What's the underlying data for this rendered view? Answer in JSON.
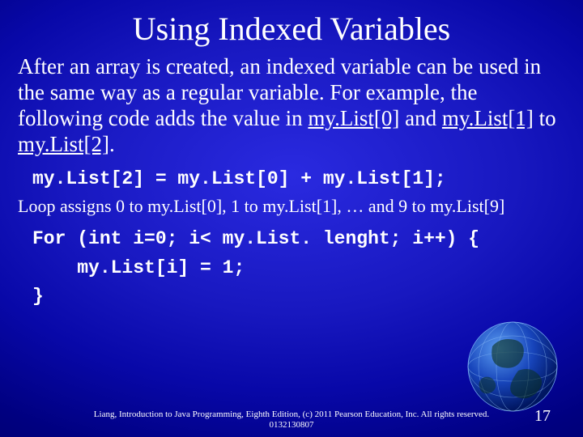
{
  "title": "Using Indexed Variables",
  "para_lead": "After an array is created, an indexed variable can be used in the same way as a regular variable. For example, the following code adds the value in ",
  "ref0": "my.List[0]",
  "mid1": " and ",
  "ref1": "my.List[1]",
  "mid2": " to ",
  "ref2": "my.List[2]",
  "tail": ".",
  "code1": "my.List[2] = my.List[0] + my.List[1];",
  "loop_note": "Loop assigns 0 to my.List[0], 1 to my.List[1], … and 9 to my.List[9]",
  "code2": "For (int i=0; i< my.List. lenght; i++) {\n    my.List[i] = 1;\n}",
  "footer": "Liang, Introduction to Java Programming, Eighth Edition, (c) 2011 Pearson Education, Inc. All rights reserved. 0132130807",
  "page_number": "17"
}
